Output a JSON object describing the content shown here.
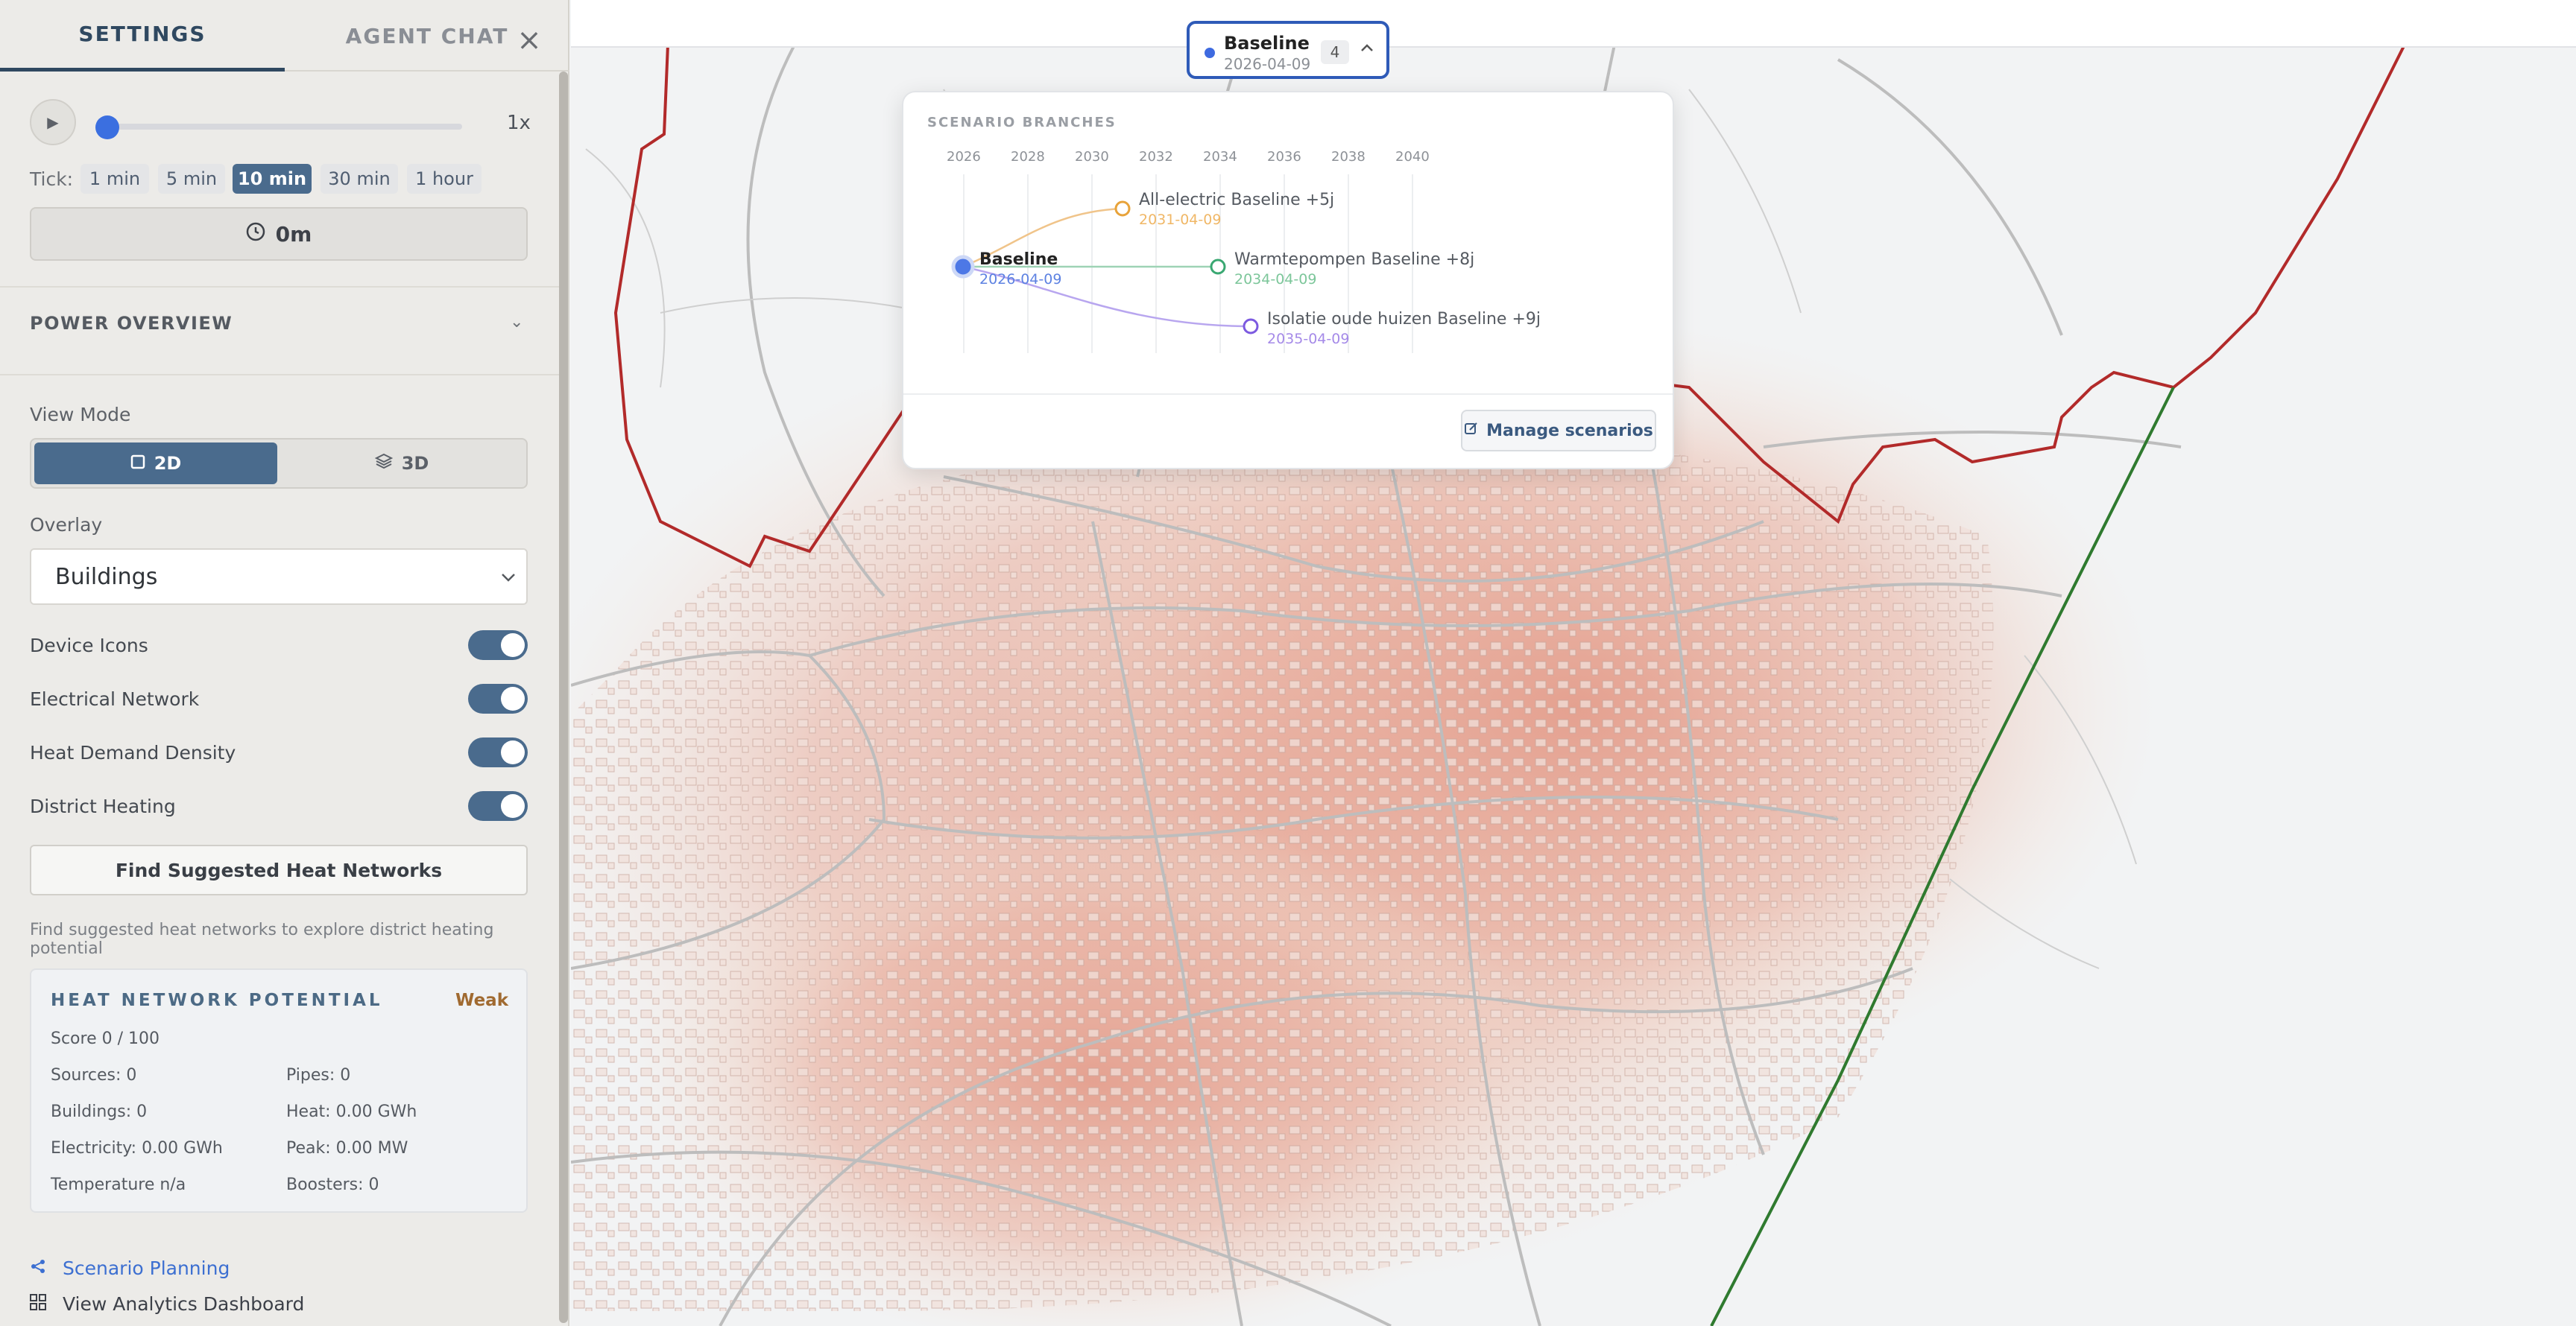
{
  "tabs": {
    "settings": "SETTINGS",
    "agent_chat": "AGENT CHAT",
    "close": "×"
  },
  "playback": {
    "play": "▶",
    "speed": "1x",
    "progress": 0.0
  },
  "tick": {
    "label": "Tick:",
    "options": [
      "1 min",
      "5 min",
      "10 min",
      "30 min",
      "1 hour"
    ],
    "active": "10 min"
  },
  "time": {
    "value": "0m",
    "icon": "clock-icon"
  },
  "power_overview": {
    "title": "POWER OVERVIEW",
    "chevron": "⌄"
  },
  "view_mode": {
    "label": "View Mode",
    "options": [
      "2D",
      "3D"
    ],
    "active": "2D"
  },
  "overlay": {
    "label": "Overlay",
    "value": "Buildings"
  },
  "toggles": [
    {
      "label": "Device Icons",
      "on": true
    },
    {
      "label": "Electrical Network",
      "on": true
    },
    {
      "label": "Heat Demand Density",
      "on": true
    },
    {
      "label": "District Heating",
      "on": true
    }
  ],
  "find_button": "Find Suggested Heat Networks",
  "find_note": "Find suggested heat networks to explore district heating potential",
  "heat_network": {
    "title": "HEAT NETWORK POTENTIAL",
    "rating": "Weak",
    "score": "Score 0 / 100",
    "sources": "Sources: 0",
    "pipes": "Pipes: 0",
    "buildings": "Buildings: 0",
    "heat": "Heat: 0.00 GWh",
    "electricity": "Electricity: 0.00 GWh",
    "peak": "Peak: 0.00 MW",
    "temperature": "Temperature n/a",
    "boosters": "Boosters: 0"
  },
  "footer": {
    "scenario_planning": "Scenario Planning",
    "analytics": "View Analytics Dashboard"
  },
  "scenario_pill": {
    "name": "Baseline",
    "date": "2026-04-09",
    "count": "4",
    "chevron": "^"
  },
  "branches": {
    "title": "SCENARIO BRANCHES",
    "years": [
      "2026",
      "2028",
      "2030",
      "2032",
      "2034",
      "2036",
      "2038",
      "2040"
    ],
    "nodes": [
      {
        "label": "Baseline",
        "date": "2026-04-09",
        "color": "#3e6ae0"
      },
      {
        "label": "All-electric Baseline +5j",
        "date": "2031-04-09",
        "color": "#e8a33a"
      },
      {
        "label": "Warmtepompen Baseline +8j",
        "date": "2034-04-09",
        "color": "#3aa872"
      },
      {
        "label": "Isolatie oude huizen Baseline +9j",
        "date": "2035-04-09",
        "color": "#7c5ae0"
      }
    ],
    "manage": "Manage scenarios"
  },
  "colors": {
    "accent": "#4a6b8d",
    "link": "#3c6fd1",
    "boundary": "#b22a2a",
    "rail": "#2f7a2f"
  }
}
